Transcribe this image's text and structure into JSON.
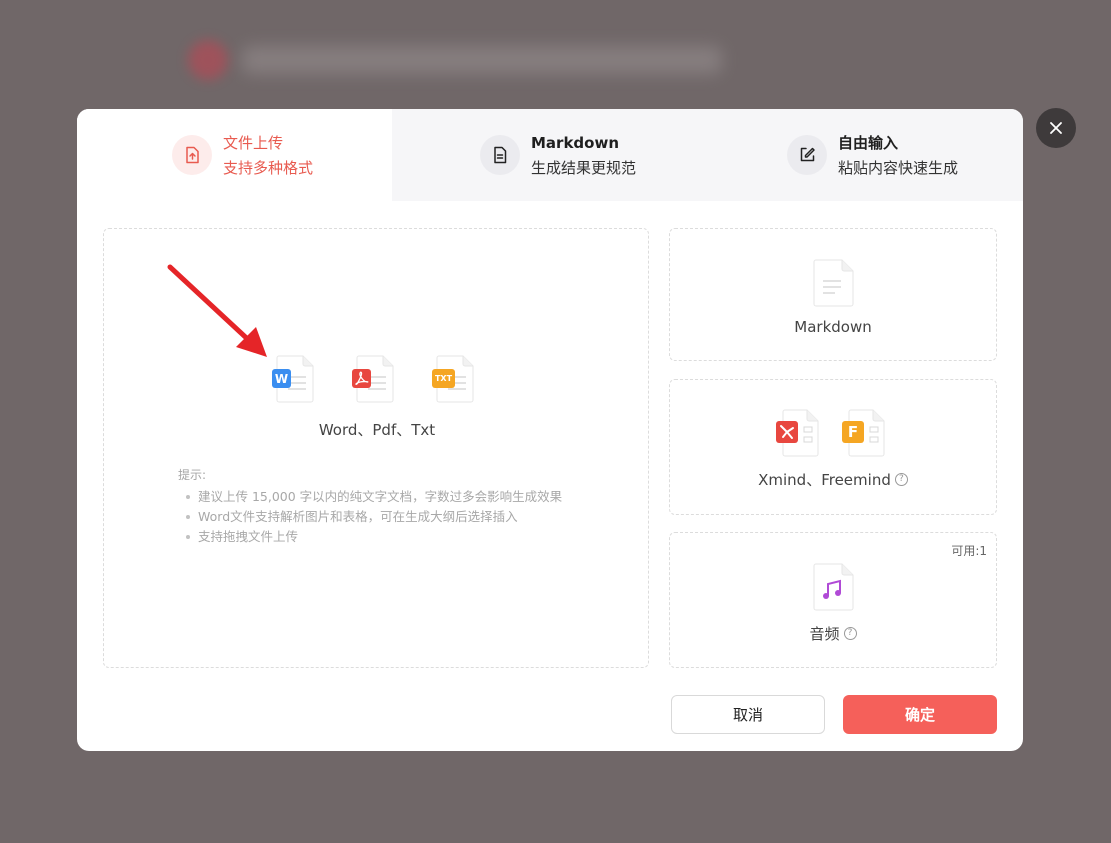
{
  "tabs": [
    {
      "title": "文件上传",
      "subtitle": "支持多种格式",
      "icon": "upload-file-icon"
    },
    {
      "title": "Markdown",
      "subtitle": "生成结果更规范",
      "icon": "document-icon"
    },
    {
      "title": "自由输入",
      "subtitle": "粘贴内容快速生成",
      "icon": "edit-icon"
    }
  ],
  "upload": {
    "formats_label": "Word、Pdf、Txt",
    "file_badges": {
      "word": "W",
      "txt": "TXT"
    },
    "tips_title": "提示:",
    "tips": [
      "建议上传 15,000 字以内的纯文字文档，字数过多会影响生成效果",
      "Word文件支持解析图片和表格，可在生成大纲后选择插入",
      "支持拖拽文件上传"
    ]
  },
  "cards": {
    "markdown": {
      "label": "Markdown"
    },
    "xmind": {
      "label": "Xmind、Freemind",
      "freemind_badge": "F"
    },
    "audio": {
      "label": "音频",
      "available": "可用:1"
    }
  },
  "help_glyph": "?",
  "buttons": {
    "cancel": "取消",
    "ok": "确定"
  },
  "colors": {
    "accent": "#e85a4f",
    "primary_button": "#f5605a",
    "word": "#3a8ef0",
    "pdf": "#e8473f",
    "txt": "#f5a623",
    "audio": "#b04ad6"
  }
}
